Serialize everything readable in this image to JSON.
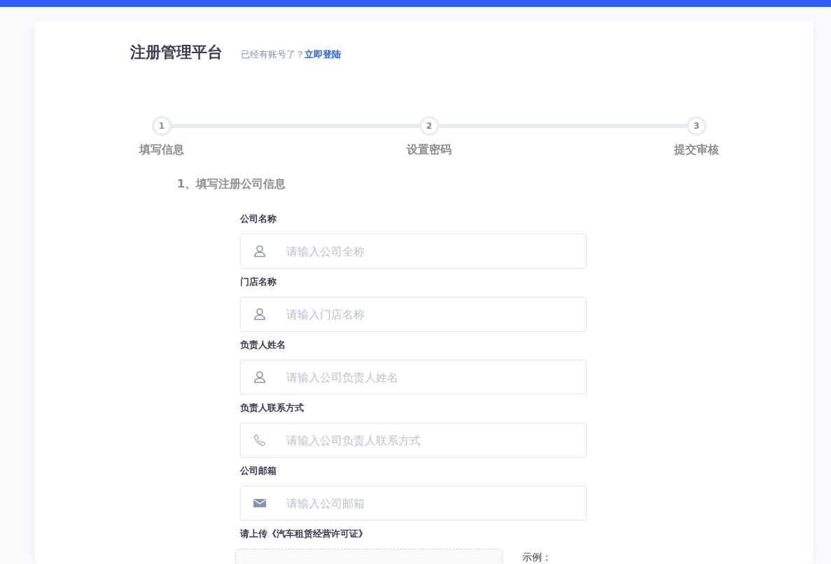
{
  "header": {
    "title": "注册管理平台",
    "prompt": "已经有账号了？",
    "login_link": "立即登陆"
  },
  "steps": [
    {
      "number": "1",
      "label": "填写信息"
    },
    {
      "number": "2",
      "label": "设置密码"
    },
    {
      "number": "3",
      "label": "提交审核"
    }
  ],
  "section_title": "1、填写注册公司信息",
  "fields": [
    {
      "label": "公司名称",
      "kind": "user",
      "placeholder": "请输入公司全称"
    },
    {
      "label": "门店名称",
      "kind": "user",
      "placeholder": "请输入门店名称"
    },
    {
      "label": "负责人姓名",
      "kind": "user",
      "placeholder": "请输入公司负责人姓名"
    },
    {
      "label": "负责人联系方式",
      "kind": "phone",
      "placeholder": "请输入公司负责人联系方式"
    },
    {
      "label": "公司邮箱",
      "kind": "mail",
      "placeholder": "请输入公司邮箱"
    }
  ],
  "upload": {
    "label": "请上传《汽车租赁经营许可证》",
    "example_label": "示例："
  }
}
